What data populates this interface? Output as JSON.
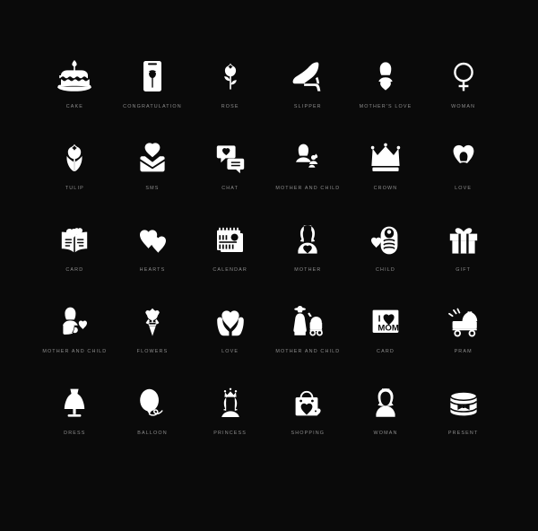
{
  "page": {
    "background_color": "#0a0a0a",
    "icon_color": "#ffffff",
    "label_color": "#8d8d8d",
    "columns": 6,
    "rows": 5,
    "total_icons": 30
  },
  "icons": [
    {
      "label": "CAKE",
      "icon": "cake-icon"
    },
    {
      "label": "CONGRATULATION",
      "icon": "congratulation-card-icon"
    },
    {
      "label": "ROSE",
      "icon": "rose-icon"
    },
    {
      "label": "SLIPPER",
      "icon": "slipper-icon"
    },
    {
      "label": "MOTHER'S LOVE",
      "icon": "mothers-love-icon"
    },
    {
      "label": "WOMAN",
      "icon": "woman-venus-symbol-icon"
    },
    {
      "label": "TULIP",
      "icon": "tulip-icon"
    },
    {
      "label": "SMS",
      "icon": "sms-envelope-heart-icon"
    },
    {
      "label": "CHAT",
      "icon": "chat-bubbles-icon"
    },
    {
      "label": "MOTHER AND CHILD",
      "icon": "mother-and-child-icon"
    },
    {
      "label": "CROWN",
      "icon": "crown-icon"
    },
    {
      "label": "LOVE",
      "icon": "love-heart-portrait-icon"
    },
    {
      "label": "CARD",
      "icon": "card-open-hearts-icon"
    },
    {
      "label": "HEARTS",
      "icon": "hearts-icon"
    },
    {
      "label": "CALENDAR",
      "icon": "calendar-icon"
    },
    {
      "label": "MOTHER",
      "icon": "mother-icon"
    },
    {
      "label": "CHILD",
      "icon": "child-swaddled-baby-icon"
    },
    {
      "label": "GIFT",
      "icon": "gift-box-icon"
    },
    {
      "label": "MOTHER AND CHILD",
      "icon": "mother-holding-baby-icon"
    },
    {
      "label": "FLOWERS",
      "icon": "flowers-bouquet-icon"
    },
    {
      "label": "LOVE",
      "icon": "hands-holding-heart-icon"
    },
    {
      "label": "MOTHER AND CHILD",
      "icon": "mother-with-pram-icon"
    },
    {
      "label": "CARD",
      "icon": "i-love-mom-card-icon"
    },
    {
      "label": "PRAM",
      "icon": "pram-icon"
    },
    {
      "label": "DRESS",
      "icon": "dress-mannequin-icon"
    },
    {
      "label": "BALLOON",
      "icon": "balloon-icon"
    },
    {
      "label": "PRINCESS",
      "icon": "princess-icon"
    },
    {
      "label": "SHOPPING",
      "icon": "shopping-bag-heart-icon"
    },
    {
      "label": "WOMAN",
      "icon": "woman-portrait-icon"
    },
    {
      "label": "PRESENT",
      "icon": "present-round-box-icon"
    }
  ],
  "card_text": {
    "line1": "I",
    "heart": "♥",
    "line2": "MOM"
  }
}
